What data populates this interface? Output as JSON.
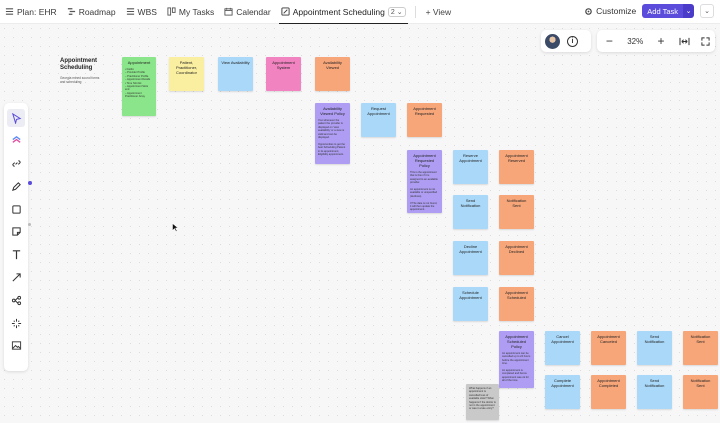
{
  "tabs": [
    {
      "label": "Plan: EHR",
      "icon": "list-icon"
    },
    {
      "label": "Roadmap",
      "icon": "gantt-icon"
    },
    {
      "label": "WBS",
      "icon": "list-icon"
    },
    {
      "label": "My Tasks",
      "icon": "board-icon"
    },
    {
      "label": "Calendar",
      "icon": "calendar-icon"
    },
    {
      "label": "Appointment Scheduling",
      "icon": "whiteboard-icon",
      "badge": "2"
    }
  ],
  "add_view_label": "+ View",
  "customize_label": "Customize",
  "add_task_label": "Add Task",
  "zoom": "32%",
  "board": {
    "title": "Appointment Scheduling",
    "subtitle": "Georgia mined sound forms and scheduling"
  },
  "notes": {
    "appointment": {
      "title": "Appointment",
      "body": "• Fields:\n– Provider Profile\n– Practitioner Profile\n– Appointment Details\n• Time Slot list\n– Appointment Slots end\n– Appointment Practitioner Array"
    },
    "pcp": {
      "title": "Patient, Practitioner, Coordinator"
    },
    "view_availability": {
      "title": "View Availability"
    },
    "appointment_system": {
      "title": "Appointment System"
    },
    "availability_viewed": {
      "title": "Availability Viewed"
    },
    "availability_viewed_policy": {
      "title": "Availability Viewed Policy",
      "body": "If so whenever the patient the provider is displayed on 'view availability' or a view is valid and can be displayed.\n\nOpportunities to get the best Scheduling Patient in its appointment, Eligibility appointment."
    },
    "request_appointment": {
      "title": "Request Appointment"
    },
    "appointment_requested": {
      "title": "Appointment Requested"
    },
    "appointment_requested_policy": {
      "title": "Appointment Requested Policy",
      "body": "This is the appointment that is then if it is assigned to an available provider.\n\nAn appointment is not available or unspecified (declines).\n\nIf The date is not found, it will then update the appointment."
    },
    "reserve_appointment": {
      "title": "Reserve Appointment"
    },
    "appointment_reserved": {
      "title": "Appointment Reserved"
    },
    "send_notification_1": {
      "title": "Send Notification"
    },
    "notification_sent_1": {
      "title": "Notification Sent"
    },
    "decline_appointment": {
      "title": "Decline Appointment"
    },
    "appointment_declined": {
      "title": "Appointment Declined"
    },
    "schedule_appointment": {
      "title": "Schedule Appointment"
    },
    "appointment_scheduled": {
      "title": "Appointment Scheduled"
    },
    "appointment_scheduled_policy": {
      "title": "Appointment Scheduled Policy",
      "body": "An appointment can be cancelled up to 24 hours before the appointment time.\n\nAn appointment is completed and hence appointment was ok for all of the time."
    },
    "cancel_appointment": {
      "title": "Cancel Appointment"
    },
    "appointment_canceled": {
      "title": "Appointment Canceled"
    },
    "send_notification_2": {
      "title": "Send Notification"
    },
    "notification_sent_2": {
      "title": "Notification Sent"
    },
    "complete_appointment": {
      "title": "Complete Appointment"
    },
    "appointment_completed": {
      "title": "Appointment Completed"
    },
    "send_notification_3": {
      "title": "Send Notification"
    },
    "notification_sent_3": {
      "title": "Notification Sent"
    },
    "question_note": {
      "body": "What happens if an appointment is cancelled less of available slots? What happens if the doctor is not in the appointment or was it a late entry?"
    }
  },
  "colors": {
    "accent": "#5b4cdb",
    "yellow": "#faeea1",
    "blue": "#a9d8f8",
    "pink": "#f283c1",
    "orange": "#f7a67a",
    "purple": "#ae9df3",
    "green": "#8be58a"
  }
}
